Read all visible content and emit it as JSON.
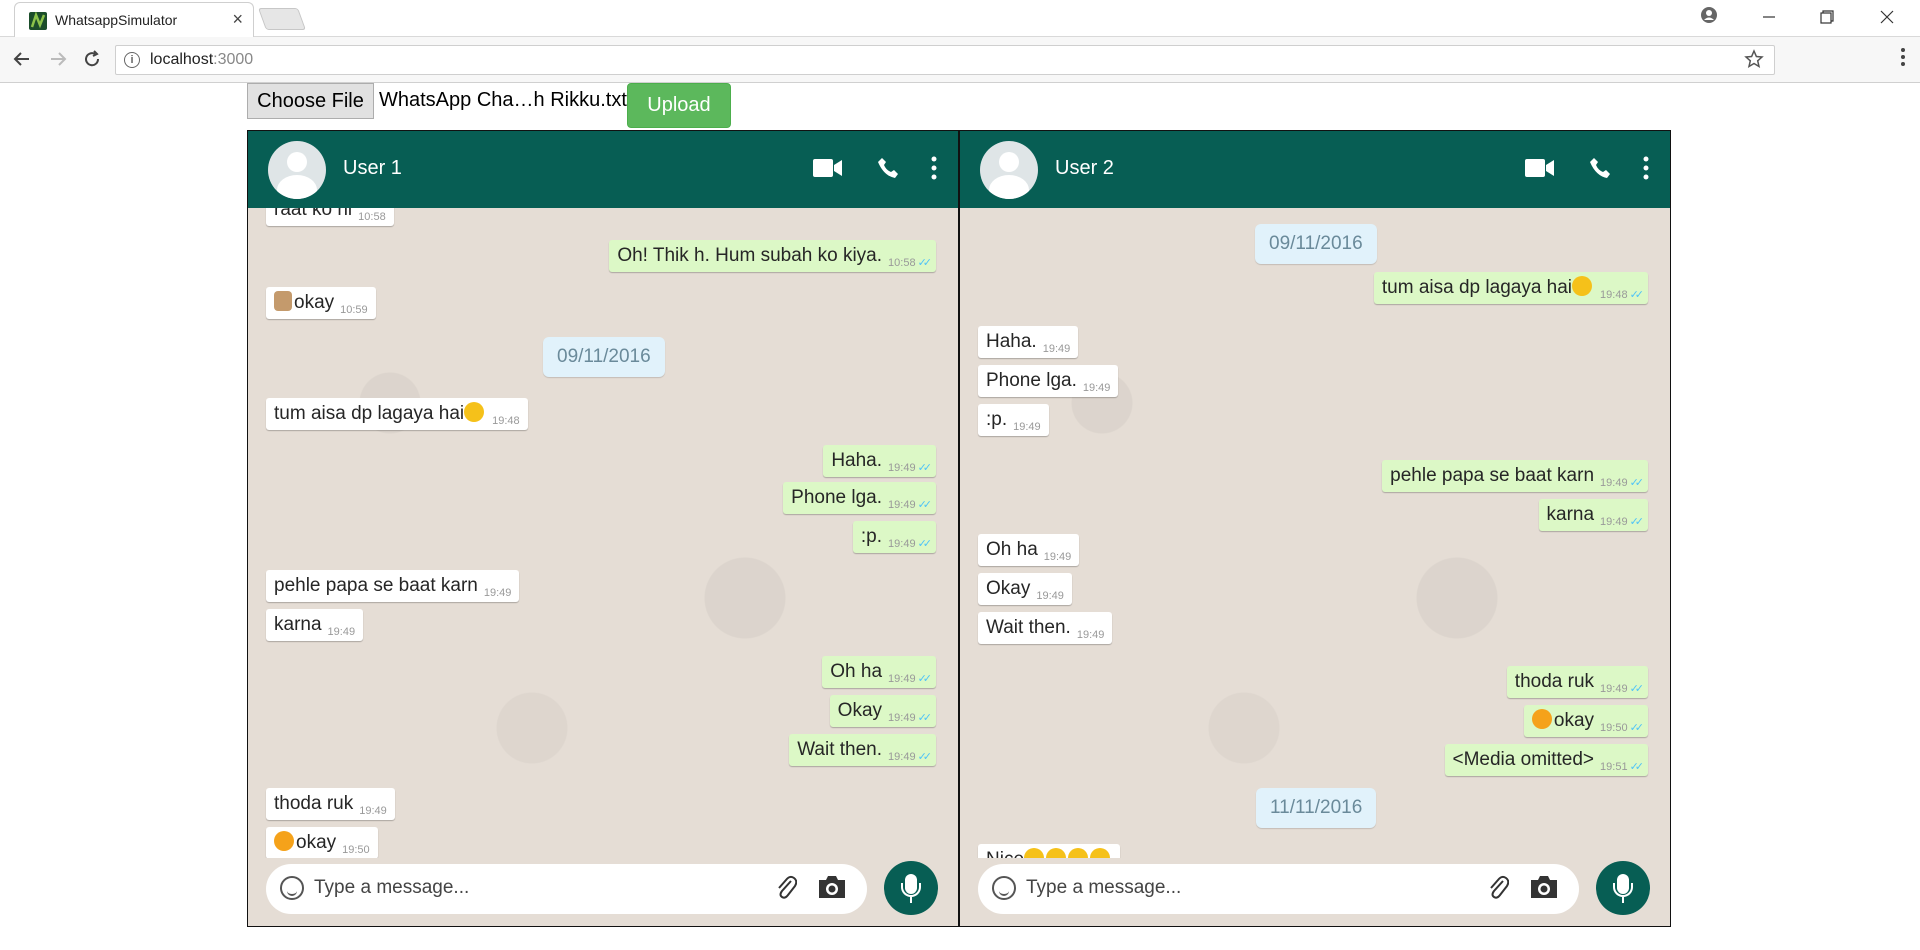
{
  "browser": {
    "tab_title": "WhatsappSimulator",
    "tab_close": "×",
    "url_host": "localhost",
    "url_port": ":3000"
  },
  "upload": {
    "choose_label": "Choose File",
    "file_name": "WhatsApp Cha…h Rikku.txt",
    "upload_label": "Upload"
  },
  "panels": [
    {
      "user_name": "User 1",
      "placeholder": "Type a message...",
      "messages": [
        {
          "type": "in",
          "text": "raat ko hi",
          "time": "10:58"
        },
        {
          "type": "out",
          "text": "Oh! Thik h. Hum subah ko kiya.",
          "time": "10:58"
        },
        {
          "type": "in",
          "text": "okay",
          "time": "10:59",
          "emoji": "thumbs-up-emoji"
        },
        {
          "type": "date",
          "text": "09/11/2016"
        },
        {
          "type": "in",
          "text": "tum aisa dp lagaya hai",
          "time": "19:48",
          "emoji_after": "worried-face-emoji"
        },
        {
          "type": "out",
          "text": "Haha.",
          "time": "19:49"
        },
        {
          "type": "out",
          "text": "Phone lga.",
          "time": "19:49"
        },
        {
          "type": "out",
          "text": ":p.",
          "time": "19:49"
        },
        {
          "type": "in",
          "text": "pehle papa se baat karn",
          "time": "19:49"
        },
        {
          "type": "in",
          "text": "karna",
          "time": "19:49"
        },
        {
          "type": "out",
          "text": "Oh ha",
          "time": "19:49"
        },
        {
          "type": "out",
          "text": "Okay",
          "time": "19:49"
        },
        {
          "type": "out",
          "text": "Wait then.",
          "time": "19:49"
        },
        {
          "type": "in",
          "text": "thoda ruk",
          "time": "19:49"
        },
        {
          "type": "in",
          "text": "okay",
          "time": "19:50",
          "emoji": "tongue-face-emoji"
        }
      ]
    },
    {
      "user_name": "User 2",
      "placeholder": "Type a message...",
      "messages": [
        {
          "type": "date",
          "text": "09/11/2016"
        },
        {
          "type": "out",
          "text": "tum aisa dp lagaya hai",
          "time": "19:48",
          "emoji_after": "worried-face-emoji"
        },
        {
          "type": "in",
          "text": "Haha.",
          "time": "19:49"
        },
        {
          "type": "in",
          "text": "Phone lga.",
          "time": "19:49"
        },
        {
          "type": "in",
          "text": ":p.",
          "time": "19:49"
        },
        {
          "type": "out",
          "text": "pehle papa se baat karn",
          "time": "19:49"
        },
        {
          "type": "out",
          "text": "karna",
          "time": "19:49"
        },
        {
          "type": "in",
          "text": "Oh ha",
          "time": "19:49"
        },
        {
          "type": "in",
          "text": "Okay",
          "time": "19:49"
        },
        {
          "type": "in",
          "text": "Wait then.",
          "time": "19:49"
        },
        {
          "type": "out",
          "text": "thoda ruk",
          "time": "19:49"
        },
        {
          "type": "out",
          "text": "okay",
          "time": "19:50",
          "emoji": "tongue-face-emoji"
        },
        {
          "type": "out",
          "text": "<Media omitted>",
          "time": "19:51"
        },
        {
          "type": "date",
          "text": "11/11/2016"
        },
        {
          "type": "in",
          "text": "Nice",
          "time": "",
          "emoji_after": "crying-laughing-emoji"
        }
      ]
    }
  ],
  "colors": {
    "header": "#075e54",
    "outgoing": "#dcf8c6",
    "incoming": "#ffffff",
    "wallpaper": "#e5ddd5",
    "upload_green": "#5cb85c",
    "read_ticks": "#4fc3f7"
  }
}
